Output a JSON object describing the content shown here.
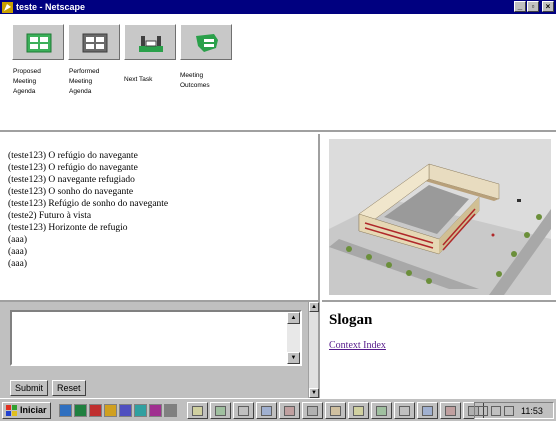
{
  "window": {
    "title": "teste - Netscape"
  },
  "toolbar": [
    {
      "name": "proposed-agenda-button",
      "label": "Proposed\nMeeting\nAgenda",
      "icon": "agenda-icon",
      "color": "#3cb05a"
    },
    {
      "name": "performed-agenda-button",
      "label": "Performed\nMeeting\nAgenda",
      "icon": "agenda-icon",
      "color": "#6a6a6a"
    },
    {
      "name": "next-task-button",
      "label": "Next Task",
      "icon": "next-task-icon",
      "color": "#2aa04a"
    },
    {
      "name": "meeting-outcomes-button",
      "label": "Meeting\nOutcomes",
      "icon": "outcomes-icon",
      "color": "#2aa04a"
    }
  ],
  "chat": {
    "messages": [
      "(teste123) O refúgio do navegante",
      "(teste123) O refúgio do navegante",
      "(teste123) O navegante refugiado",
      "(teste123) O sonho do navegante",
      "(teste123) Refúgio de sonho do navegante",
      "(teste2) Futuro à vista",
      "(teste123) Horizonte de refugio",
      "(aaa)",
      "(aaa)",
      "(aaa)"
    ]
  },
  "input": {
    "value": "",
    "submit_label": "Submit",
    "reset_label": "Reset"
  },
  "slogan": {
    "title": "Slogan",
    "link": "Context Index"
  },
  "taskbar": {
    "start_label": "Iniciar",
    "clock": "11:53",
    "quicklaunch_count": 8,
    "task_count": 13
  }
}
